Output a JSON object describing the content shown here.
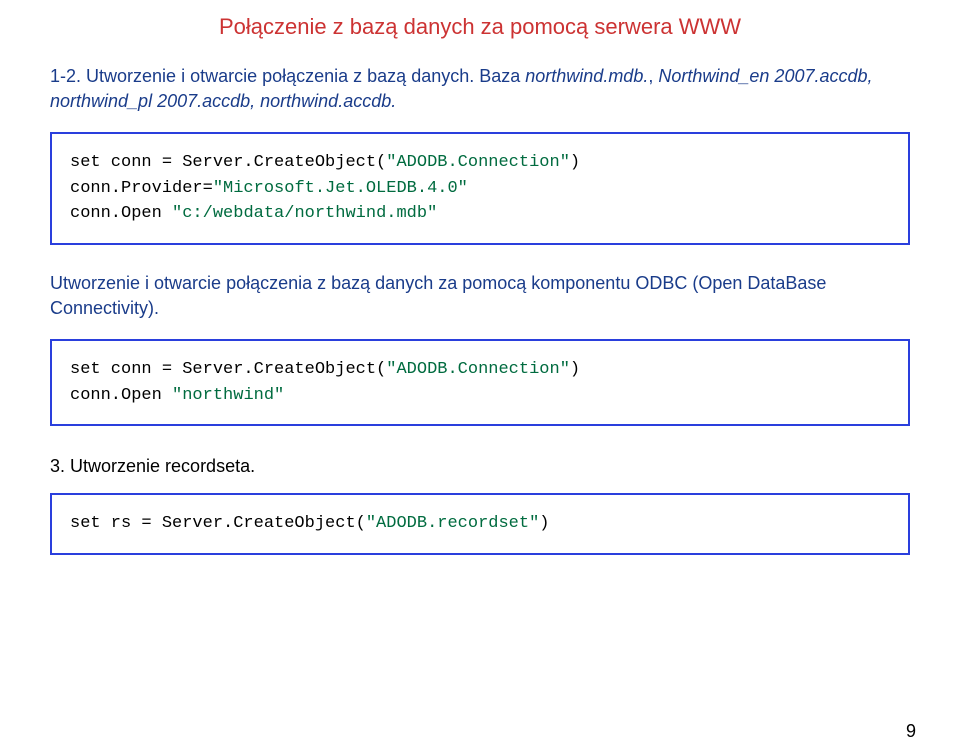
{
  "title": "Połączenie z bazą danych za pomocą serwera WWW",
  "para1_prefix": "1-2. ",
  "para1_text": "Utworzenie i otwarcie połączenia z bazą danych. Baza ",
  "para1_italic1": "northwind.mdb.",
  "para1_text2": ", ",
  "para1_italic2": "Northwind_en 2007.accdb, northwind_pl 2007.accdb, northwind.accdb.",
  "code1_line1_k": "set conn = Server.CreateObject(",
  "code1_line1_s": "\"ADODB.Connection\"",
  "code1_line1_e": ")",
  "code1_line2_a": "conn.Provider=",
  "code1_line2_b": "\"Microsoft.Jet.OLEDB.4.0\"",
  "code1_line3_a": "conn.Open ",
  "code1_line3_b": "\"c:/webdata/northwind.mdb\"",
  "para2": "Utworzenie i otwarcie połączenia z bazą danych za pomocą komponentu ODBC (Open DataBase Connectivity).",
  "code2_line1_k": "set conn = Server.CreateObject(",
  "code2_line1_s": "\"ADODB.Connection\"",
  "code2_line1_e": ")",
  "code2_line2_a": "conn.Open ",
  "code2_line2_b": "\"northwind\"",
  "section3": "3. Utworzenie recordseta.",
  "code3_line1_k": "set rs = Server.CreateObject(",
  "code3_line1_s": "\"ADODB.recordset\"",
  "code3_line1_e": ")",
  "page_num": "9"
}
